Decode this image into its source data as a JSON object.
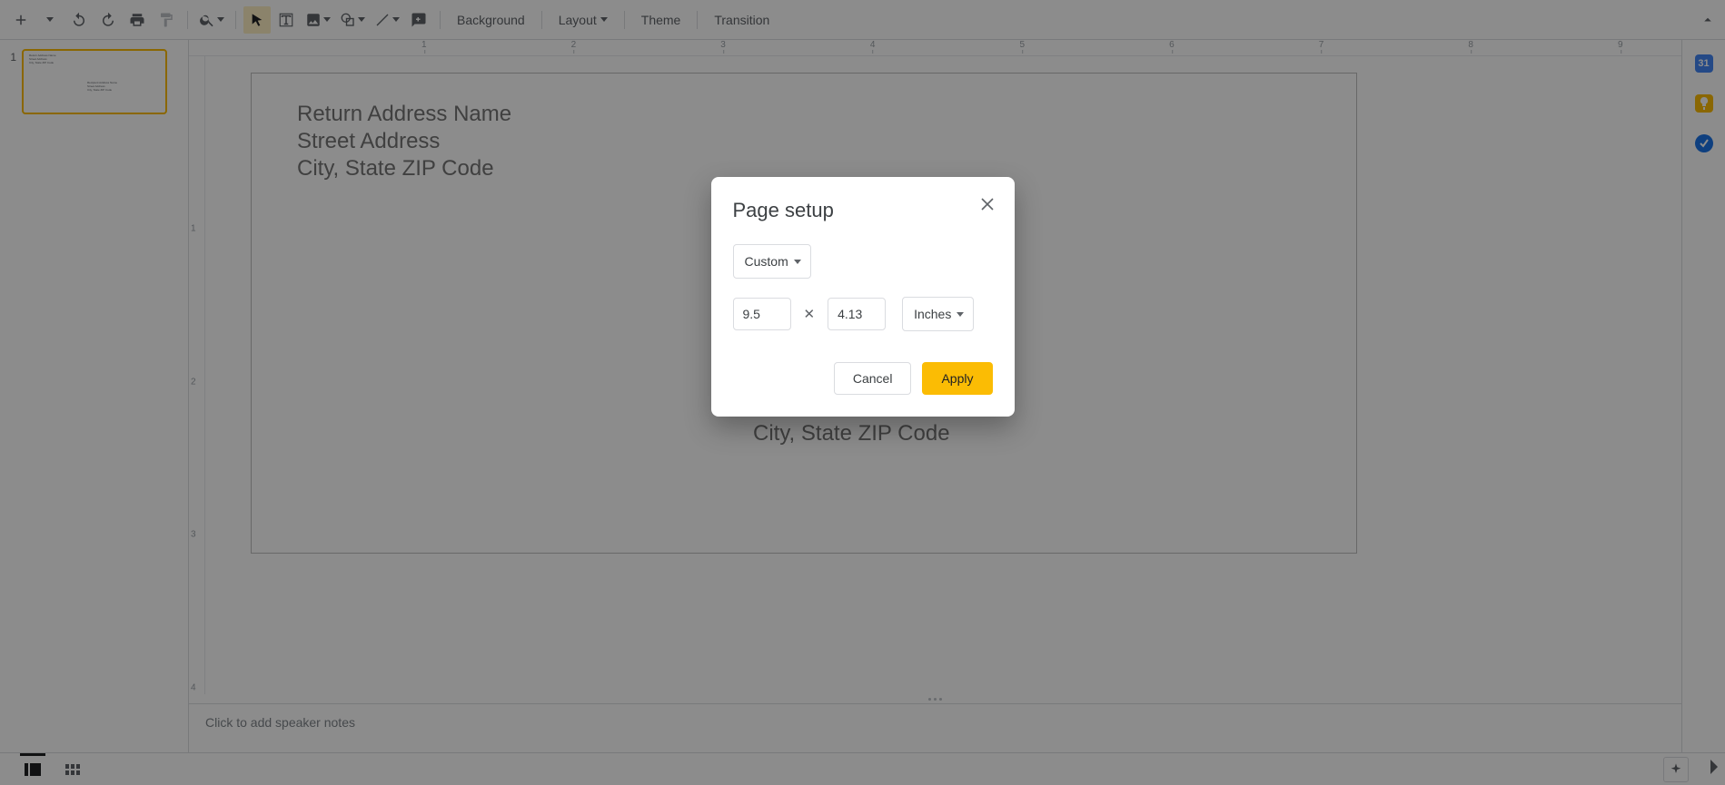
{
  "toolbar": {
    "background_label": "Background",
    "layout_label": "Layout",
    "theme_label": "Theme",
    "transition_label": "Transition"
  },
  "filmstrip": {
    "slides": [
      {
        "number": "1"
      }
    ]
  },
  "editor": {
    "return_address": {
      "line1": "Return Address Name",
      "line2": "Street Address",
      "line3": "City, State ZIP Code"
    },
    "recipient_address": {
      "line1": "Recipient Address Name",
      "line2": "Street Address",
      "line3": "City, State ZIP Code"
    },
    "ruler_h_labels": [
      "1",
      "2",
      "3",
      "4",
      "5",
      "6",
      "7",
      "8",
      "9"
    ],
    "ruler_v_labels": [
      "1",
      "2",
      "3",
      "4"
    ]
  },
  "speaker_notes": {
    "placeholder": "Click to add speaker notes"
  },
  "side_rail": {
    "calendar_glyph": "31",
    "keep_icon": "keep",
    "tasks_icon": "tasks"
  },
  "dialog": {
    "title": "Page setup",
    "size_preset": "Custom",
    "width": "9.5",
    "height": "4.13",
    "units": "Inches",
    "cancel_label": "Cancel",
    "apply_label": "Apply"
  }
}
